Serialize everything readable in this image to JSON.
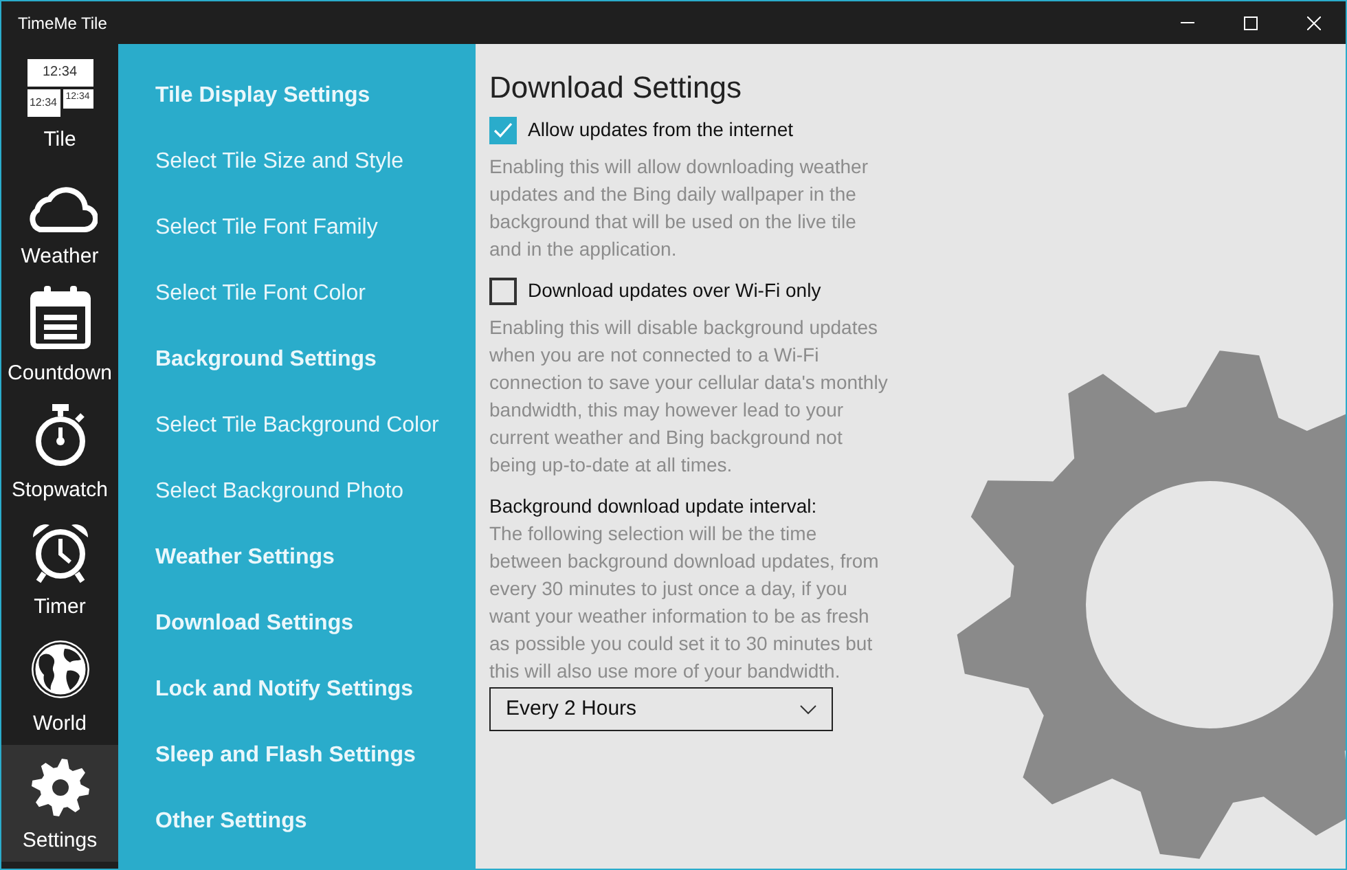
{
  "window": {
    "title": "TimeMe Tile"
  },
  "nav": [
    {
      "label": "Tile",
      "selected": false,
      "tile_texts": [
        "12:34",
        "12:34",
        "12:34"
      ]
    },
    {
      "label": "Weather",
      "selected": false
    },
    {
      "label": "Countdown",
      "selected": false
    },
    {
      "label": "Stopwatch",
      "selected": false
    },
    {
      "label": "Timer",
      "selected": false
    },
    {
      "label": "World",
      "selected": false
    },
    {
      "label": "Settings",
      "selected": true
    }
  ],
  "menu": [
    {
      "label": "Tile Display Settings",
      "kind": "header"
    },
    {
      "label": "Select Tile Size and Style",
      "kind": "item"
    },
    {
      "label": "Select Tile Font Family",
      "kind": "item"
    },
    {
      "label": "Select Tile Font Color",
      "kind": "item"
    },
    {
      "label": "Background Settings",
      "kind": "header"
    },
    {
      "label": "Select Tile Background Color",
      "kind": "item"
    },
    {
      "label": "Select Background Photo",
      "kind": "item"
    },
    {
      "label": "Weather Settings",
      "kind": "header"
    },
    {
      "label": "Download Settings",
      "kind": "header"
    },
    {
      "label": "Lock and Notify Settings",
      "kind": "header"
    },
    {
      "label": "Sleep and Flash Settings",
      "kind": "header"
    },
    {
      "label": "Other Settings",
      "kind": "header"
    }
  ],
  "content": {
    "title": "Download Settings",
    "options": [
      {
        "label": "Allow updates from the internet",
        "checked": true,
        "description": "Enabling this will allow downloading weather updates and the Bing daily wallpaper in the background that will be used on the live tile and in the application."
      },
      {
        "label": "Download updates over Wi-Fi only",
        "checked": false,
        "description": "Enabling this will disable background updates when you are not connected to a Wi-Fi connection to save your cellular data's monthly bandwidth, this may however lead to your current weather and Bing background not being up-to-date at all times."
      }
    ],
    "interval": {
      "label": "Background download update interval:",
      "description": "The following selection will be the time between background download updates, from every 30 minutes to just once a day, if you want your weather information to be as fresh as possible you could set it to 30 minutes but this will also use more of your bandwidth.",
      "value": "Every 2 Hours"
    }
  }
}
